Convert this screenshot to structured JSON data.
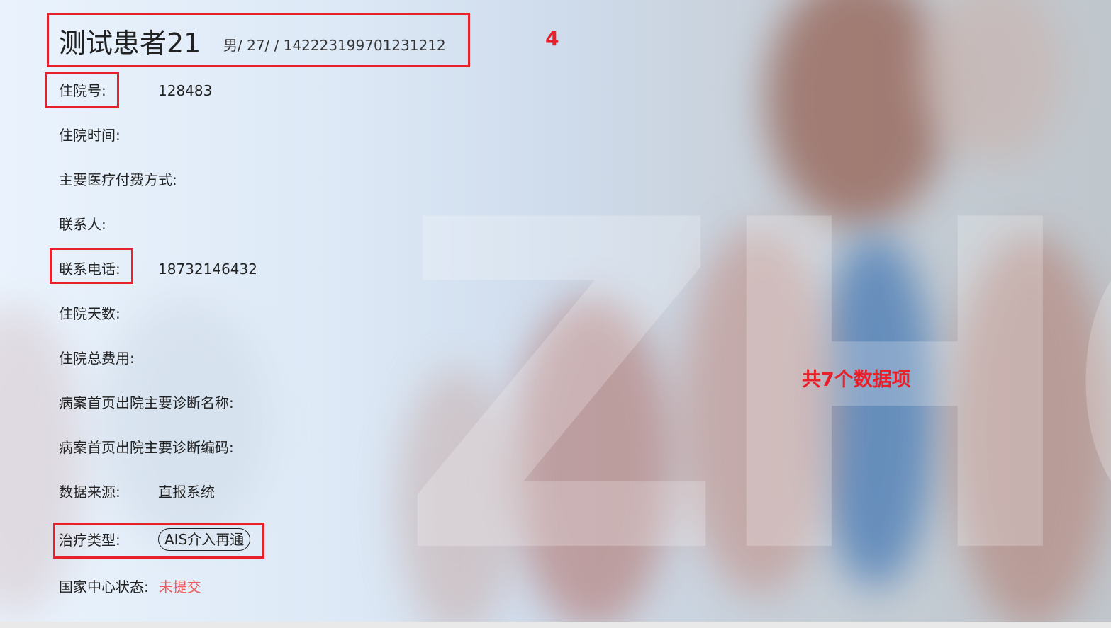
{
  "patient": {
    "name": "测试患者21",
    "meta": "男/ 27/ / 142223199701231212"
  },
  "annotations": {
    "count_label": "4",
    "total_label": "共7个数据项"
  },
  "fields": {
    "admission_no": {
      "label": "住院号:",
      "value": "128483"
    },
    "admission_time": {
      "label": "住院时间:",
      "value": ""
    },
    "payment_method": {
      "label": "主要医疗付费方式:",
      "value": ""
    },
    "contact": {
      "label": "联系人:",
      "value": ""
    },
    "contact_phone": {
      "label": "联系电话:",
      "value": "18732146432"
    },
    "stay_days": {
      "label": "住院天数:",
      "value": ""
    },
    "total_cost": {
      "label": "住院总费用:",
      "value": ""
    },
    "diagnosis_name": {
      "label": "病案首页出院主要诊断名称:",
      "value": ""
    },
    "diagnosis_code": {
      "label": "病案首页出院主要诊断编码:",
      "value": ""
    },
    "data_source": {
      "label": "数据来源:",
      "value": "直报系统"
    },
    "treatment_type": {
      "label": "治疗类型:",
      "value": "AIS介入再通"
    },
    "national_status": {
      "label": "国家中心状态:",
      "value": "未提交"
    }
  },
  "colors": {
    "annotation_red": "#e8202a",
    "status_red": "#ee5a5a"
  },
  "background_watermark": "ZHON"
}
